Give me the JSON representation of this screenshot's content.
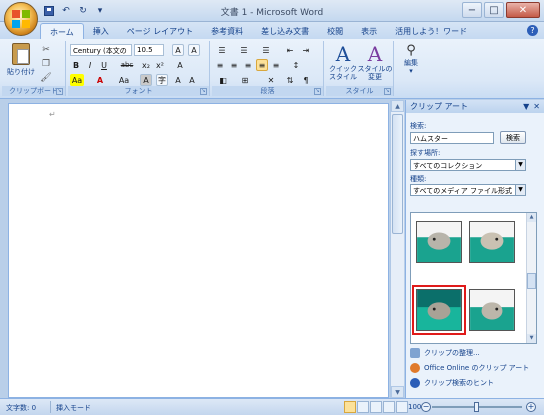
{
  "window": {
    "title": "文書 1 - Microsoft Word",
    "controls": {
      "minimize": "−",
      "maximize": "□",
      "close": "✕"
    }
  },
  "quick_access": {
    "undo": "↶",
    "redo": "↻",
    "more": "▾"
  },
  "tabs": [
    "ホーム",
    "挿入",
    "ページ レイアウト",
    "参考資料",
    "差し込み文書",
    "校閲",
    "表示",
    "活用しよう！ワード"
  ],
  "active_tab": "ホーム",
  "ribbon": {
    "clipboard": {
      "paste_label": "貼り付け",
      "group_label": "クリップボード"
    },
    "font": {
      "font_name": "Century (本文の",
      "font_size": "10.5",
      "group_label": "フォント",
      "buttons": [
        "B",
        "I",
        "U",
        "abc",
        "x₂",
        "x²",
        "A",
        "Aa",
        "A",
        "A",
        "字",
        "A",
        "A"
      ]
    },
    "paragraph": {
      "group_label": "段落"
    },
    "styles": {
      "quick_style_label": "クイック\nスタイル",
      "change_style_label": "スタイルの\n変更",
      "group_label": "スタイル"
    },
    "editing": {
      "label": "編集"
    }
  },
  "document": {
    "paragraph_mark": "↵"
  },
  "clipart_pane": {
    "title": "クリップ アート",
    "search_label": "検索:",
    "search_value": "ハムスター",
    "search_button": "検索",
    "location_label": "探す場所:",
    "location_value": "すべてのコレクション",
    "type_label": "種類:",
    "type_value": "すべてのメディア ファイル形式",
    "links": [
      "クリップの整理...",
      "Office Online のクリップ アート",
      "クリップ検索のヒント"
    ]
  },
  "statusbar": {
    "word_count": "文字数: 0",
    "mode": "挿入モード",
    "zoom": "100%"
  },
  "colors": {
    "accent": "#15428b",
    "selection_outline": "#e01a1a",
    "thumb_background": "#1aa38f"
  }
}
